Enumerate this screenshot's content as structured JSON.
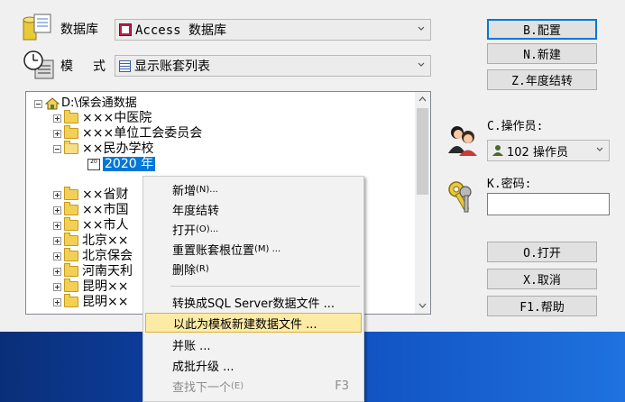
{
  "database": {
    "label": "数据库",
    "icon": "database-icon",
    "selected": "Access 数据库"
  },
  "mode": {
    "label_part1": "模",
    "label_part2": "式",
    "icon": "clock-icon",
    "selected": "显示账套列表"
  },
  "buttons": {
    "config": "B.配置",
    "new": "N.新建",
    "year_transfer": "Z.年度结转",
    "open": "O.打开",
    "cancel": "X.取消",
    "help": "F1.帮助"
  },
  "operator": {
    "label": "C.操作员:",
    "selected": "102 操作员"
  },
  "password": {
    "label": "K.密码:",
    "value": ""
  },
  "tree": {
    "root": "D:\\保会通数据",
    "items": [
      "×××中医院",
      "×××单位工会委员会",
      "××民办学校",
      "2020 年",
      "××省财",
      "××市国",
      "××市人",
      "北京××",
      "北京保会",
      "河南天利",
      "昆明××",
      "昆明××"
    ]
  },
  "context_menu": {
    "items": [
      {
        "label": "新增",
        "key": "(N)..."
      },
      {
        "label": "年度结转",
        "key": ""
      },
      {
        "label": "打开",
        "key": "(O)..."
      },
      {
        "label": "重置账套根位置",
        "key": "(M) ..."
      },
      {
        "label": "删除",
        "key": "(R)"
      },
      {
        "label": "转换成SQL Server数据文件 ...",
        "key": ""
      },
      {
        "label": "以此为模板新建数据文件 ...",
        "key": ""
      },
      {
        "label": "并账 ...",
        "key": ""
      },
      {
        "label": "成批升级 ...",
        "key": ""
      },
      {
        "label": "查找下一个",
        "key": "(E)",
        "shortcut": "F3"
      }
    ]
  },
  "colors": {
    "accent": "#0078d7",
    "highlight": "#fdeaa5",
    "taskbar": "#0d49b8"
  }
}
